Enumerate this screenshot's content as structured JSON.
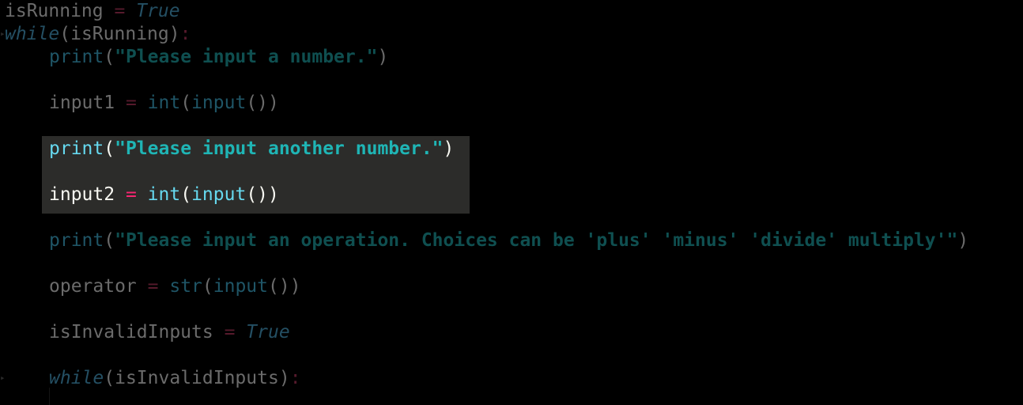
{
  "editor": {
    "line1": {
      "ident": "isRunning",
      "op": "=",
      "value": "True"
    },
    "line2": {
      "keyword": "while",
      "open": "(",
      "ident": "isRunning",
      "close": ")",
      "colon": ":"
    },
    "line3": {
      "fn": "print",
      "open": "(",
      "str": "\"Please input a number.\"",
      "close": ")"
    },
    "line4": {
      "ident": "input1",
      "op": "=",
      "fn": "int",
      "open": "(",
      "inner": "input",
      "inner_parens": "())"
    },
    "line5": {
      "fn": "print",
      "open": "(",
      "str": "\"Please input another number.\"",
      "close": ")"
    },
    "line6": {
      "ident": "input2",
      "op": "=",
      "fn": "int",
      "open": "(",
      "inner": "input",
      "inner_parens": "())"
    },
    "line7": {
      "fn": "print",
      "open": "(",
      "str": "\"Please input an operation. Choices can be 'plus' 'minus' 'divide' multiply'\"",
      "close": ")"
    },
    "line8": {
      "ident": "operator",
      "op": "=",
      "fn": "str",
      "open": "(",
      "inner": "input",
      "inner_parens": "())"
    },
    "line9": {
      "ident": "isInvalidInputs",
      "op": "=",
      "value": "True"
    },
    "line10": {
      "keyword": "while",
      "open": "(",
      "ident": "isInvalidInputs",
      "close": ")",
      "colon": ":"
    }
  },
  "theme": {
    "background": "#000000",
    "selection": "#2c2c2a",
    "string_active": "#1fb5b5",
    "function_active": "#66d9ef",
    "operator_active": "#f92672"
  }
}
